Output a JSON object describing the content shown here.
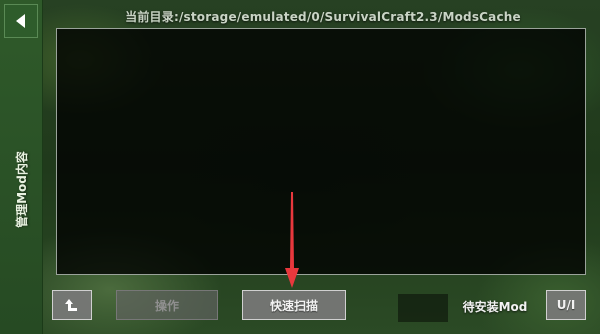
{
  "sidebar": {
    "back_icon": "back-arrow-icon",
    "tab_label": "管理Mod内容"
  },
  "header": {
    "path": "当前目录:/storage/emulated/0/SurvivalCraft2.3/ModsCache"
  },
  "toolbar": {
    "up_icon": "up-arrow-icon",
    "operate_label": "操作",
    "scan_label": "快速扫描",
    "pending_label": "待安装Mod",
    "ui_label": "U/I"
  },
  "annotation": {
    "arrow_color": "#e8383d"
  }
}
